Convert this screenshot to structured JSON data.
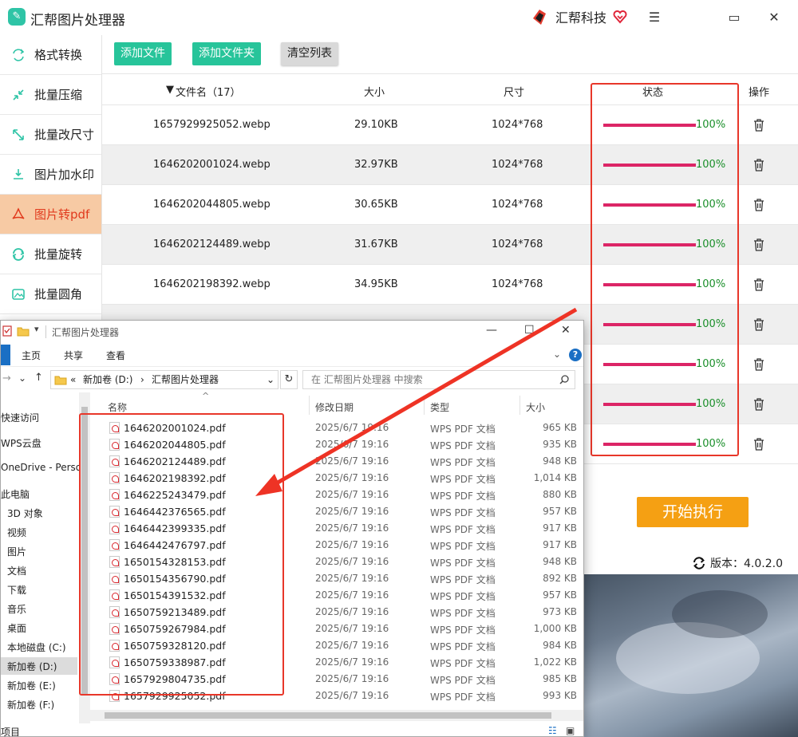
{
  "app": {
    "title": "汇帮图片处理器",
    "brand": "汇帮科技",
    "window_controls": [
      "menu-icon",
      "maximize-icon",
      "close-icon"
    ]
  },
  "sidebar": {
    "items": [
      {
        "label": "格式转换",
        "icon": "convert-icon"
      },
      {
        "label": "批量压缩",
        "icon": "compress-icon"
      },
      {
        "label": "批量改尺寸",
        "icon": "resize-icon"
      },
      {
        "label": "图片加水印",
        "icon": "watermark-icon"
      },
      {
        "label": "图片转pdf",
        "icon": "pdf-icon",
        "active": true
      },
      {
        "label": "批量旋转",
        "icon": "rotate-icon"
      },
      {
        "label": "批量圆角",
        "icon": "round-corner-icon"
      }
    ]
  },
  "toolbar": {
    "add_file": "添加文件",
    "add_folder": "添加文件夹",
    "clear_list": "清空列表"
  },
  "table": {
    "headers": {
      "name": "文件名（17）",
      "size": "大小",
      "dimensions": "尺寸",
      "status": "状态",
      "action": "操作"
    },
    "rows": [
      {
        "name": "1657929925052.webp",
        "size": "29.10KB",
        "dimensions": "1024*768",
        "progress": "100%"
      },
      {
        "name": "1646202001024.webp",
        "size": "32.97KB",
        "dimensions": "1024*768",
        "progress": "100%"
      },
      {
        "name": "1646202044805.webp",
        "size": "30.65KB",
        "dimensions": "1024*768",
        "progress": "100%"
      },
      {
        "name": "1646202124489.webp",
        "size": "31.67KB",
        "dimensions": "1024*768",
        "progress": "100%"
      },
      {
        "name": "1646202198392.webp",
        "size": "34.95KB",
        "dimensions": "1024*768",
        "progress": "100%"
      },
      {
        "name": "",
        "size": "",
        "dimensions": "",
        "progress": "100%"
      },
      {
        "name": "",
        "size": "",
        "dimensions": "",
        "progress": "100%"
      },
      {
        "name": "",
        "size": "",
        "dimensions": "",
        "progress": "100%"
      },
      {
        "name": "",
        "size": "",
        "dimensions": "",
        "progress": "100%"
      }
    ],
    "progress_fraction": 1.0
  },
  "start_button": "开始执行",
  "version": "版本：4.0.2.0",
  "colors": {
    "accent_green": "#27c49a",
    "active_tab_bg": "#f7caa4",
    "active_tab_text": "#e13a1d",
    "progress": "#dc2566",
    "percent_text": "#1a8f2a",
    "start_button": "#f5a013",
    "highlight_box": "#e8372a"
  },
  "explorer": {
    "title": "汇帮图片处理器",
    "tabs": [
      "主页",
      "共享",
      "查看"
    ],
    "breadcrumb": {
      "prefix": "«",
      "drive": "新加卷 (D:)",
      "sep": "›",
      "folder": "汇帮图片处理器"
    },
    "search_placeholder": "在 汇帮图片处理器 中搜索",
    "columns": {
      "name": "名称",
      "date": "修改日期",
      "type": "类型",
      "size": "大小"
    },
    "nav": [
      {
        "label": "快速访问"
      },
      {
        "label": "WPS云盘"
      },
      {
        "label": "OneDrive - Perso"
      },
      {
        "label": "此电脑"
      },
      {
        "label": "3D 对象"
      },
      {
        "label": "视频"
      },
      {
        "label": "图片"
      },
      {
        "label": "文档"
      },
      {
        "label": "下载"
      },
      {
        "label": "音乐"
      },
      {
        "label": "桌面"
      },
      {
        "label": "本地磁盘 (C:)"
      },
      {
        "label": "新加卷 (D:)",
        "selected": true
      },
      {
        "label": "新加卷 (E:)"
      },
      {
        "label": "新加卷 (F:)"
      }
    ],
    "files": [
      {
        "name": "1646202001024.pdf",
        "date": "2025/6/7 19:16",
        "type": "WPS PDF 文档",
        "size": "965 KB"
      },
      {
        "name": "1646202044805.pdf",
        "date": "2025/6/7 19:16",
        "type": "WPS PDF 文档",
        "size": "935 KB"
      },
      {
        "name": "1646202124489.pdf",
        "date": "2025/6/7 19:16",
        "type": "WPS PDF 文档",
        "size": "948 KB"
      },
      {
        "name": "1646202198392.pdf",
        "date": "2025/6/7 19:16",
        "type": "WPS PDF 文档",
        "size": "1,014 KB"
      },
      {
        "name": "1646225243479.pdf",
        "date": "2025/6/7 19:16",
        "type": "WPS PDF 文档",
        "size": "880 KB"
      },
      {
        "name": "1646442376565.pdf",
        "date": "2025/6/7 19:16",
        "type": "WPS PDF 文档",
        "size": "957 KB"
      },
      {
        "name": "1646442399335.pdf",
        "date": "2025/6/7 19:16",
        "type": "WPS PDF 文档",
        "size": "917 KB"
      },
      {
        "name": "1646442476797.pdf",
        "date": "2025/6/7 19:16",
        "type": "WPS PDF 文档",
        "size": "917 KB"
      },
      {
        "name": "1650154328153.pdf",
        "date": "2025/6/7 19:16",
        "type": "WPS PDF 文档",
        "size": "948 KB"
      },
      {
        "name": "1650154356790.pdf",
        "date": "2025/6/7 19:16",
        "type": "WPS PDF 文档",
        "size": "892 KB"
      },
      {
        "name": "1650154391532.pdf",
        "date": "2025/6/7 19:16",
        "type": "WPS PDF 文档",
        "size": "957 KB"
      },
      {
        "name": "1650759213489.pdf",
        "date": "2025/6/7 19:16",
        "type": "WPS PDF 文档",
        "size": "973 KB"
      },
      {
        "name": "1650759267984.pdf",
        "date": "2025/6/7 19:16",
        "type": "WPS PDF 文档",
        "size": "1,000 KB"
      },
      {
        "name": "1650759328120.pdf",
        "date": "2025/6/7 19:16",
        "type": "WPS PDF 文档",
        "size": "984 KB"
      },
      {
        "name": "1650759338987.pdf",
        "date": "2025/6/7 19:16",
        "type": "WPS PDF 文档",
        "size": "1,022 KB"
      },
      {
        "name": "1657929804735.pdf",
        "date": "2025/6/7 19:16",
        "type": "WPS PDF 文档",
        "size": "985 KB"
      },
      {
        "name": "1657929925052.pdf",
        "date": "2025/6/7 19:16",
        "type": "WPS PDF 文档",
        "size": "993 KB"
      }
    ],
    "status_text": "项目"
  }
}
